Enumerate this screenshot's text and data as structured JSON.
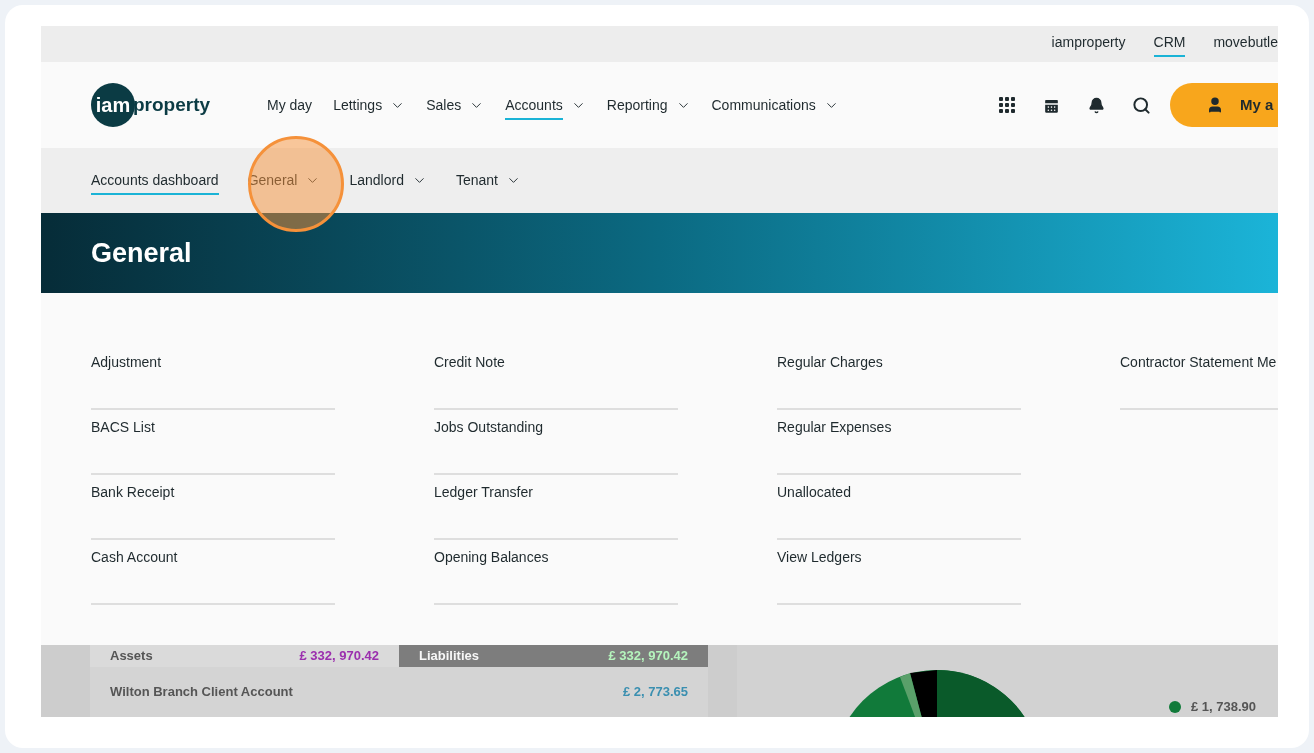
{
  "top_links": [
    {
      "label": "iamproperty",
      "selected": false
    },
    {
      "label": "CRM",
      "selected": true
    },
    {
      "label": "movebutle",
      "selected": false
    }
  ],
  "logo": {
    "mark": "iam",
    "text": "property"
  },
  "nav": [
    {
      "label": "My day",
      "dropdown": false,
      "selected": false
    },
    {
      "label": "Lettings",
      "dropdown": true,
      "selected": false
    },
    {
      "label": "Sales",
      "dropdown": true,
      "selected": false
    },
    {
      "label": "Accounts",
      "dropdown": true,
      "selected": true
    },
    {
      "label": "Reporting",
      "dropdown": true,
      "selected": false
    },
    {
      "label": "Communications",
      "dropdown": true,
      "selected": false
    }
  ],
  "account_button": {
    "label": "My a"
  },
  "subnav": [
    {
      "label": "Accounts dashboard",
      "dropdown": false,
      "selected": true,
      "highlighted": false
    },
    {
      "label": "General",
      "dropdown": true,
      "selected": false,
      "highlighted": true
    },
    {
      "label": "Landlord",
      "dropdown": true,
      "selected": false,
      "highlighted": false
    },
    {
      "label": "Tenant",
      "dropdown": true,
      "selected": false,
      "highlighted": false
    }
  ],
  "banner": {
    "title": "General"
  },
  "menu_columns": [
    [
      "Adjustment",
      "BACS List",
      "Bank Receipt",
      "Cash Account"
    ],
    [
      "Credit Note",
      "Jobs Outstanding",
      "Ledger Transfer",
      "Opening Balances"
    ],
    [
      "Regular Charges",
      "Regular Expenses",
      "Unallocated",
      "View Ledgers"
    ],
    [
      "Contractor Statement Me"
    ]
  ],
  "background": {
    "assets_label": "Assets",
    "assets_total": "£ 332, 970.42",
    "liabilities_label": "Liabilities",
    "liabilities_total": "£ 332, 970.42",
    "account_name": "Wilton Branch Client Account",
    "account_balance": "£ 2, 773.65",
    "legend_value": "£ 1, 738.90"
  }
}
